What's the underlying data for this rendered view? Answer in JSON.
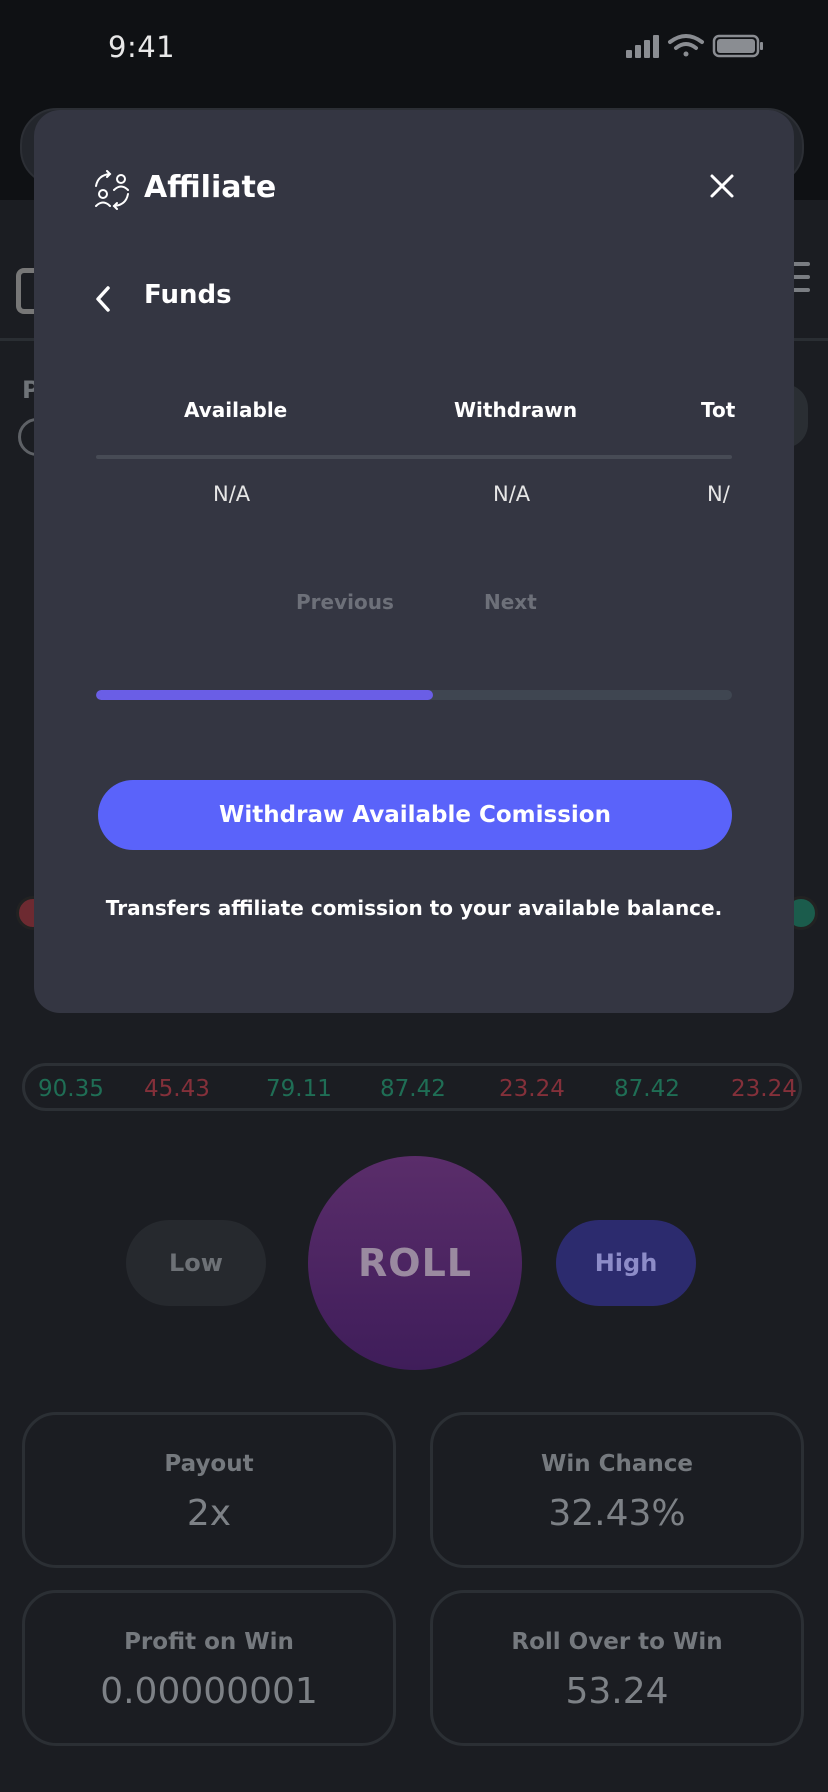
{
  "status_bar": {
    "time": "9:41"
  },
  "background": {
    "partial_label": "P",
    "history": [
      {
        "value": "90.35",
        "color": "green"
      },
      {
        "value": "45.43",
        "color": "red"
      },
      {
        "value": "79.11",
        "color": "green"
      },
      {
        "value": "87.42",
        "color": "green"
      },
      {
        "value": "23.24",
        "color": "red"
      },
      {
        "value": "87.42",
        "color": "green"
      },
      {
        "value": "23.24",
        "color": "red"
      }
    ],
    "buttons": {
      "low": "Low",
      "roll": "ROLL",
      "high": "High"
    },
    "stats": {
      "payout": {
        "label": "Payout",
        "value": "2x"
      },
      "win_chance": {
        "label": "Win Chance",
        "value": "32.43%"
      },
      "profit_on_win": {
        "label": "Profit on Win",
        "value": "0.00000001"
      },
      "roll_over": {
        "label": "Roll Over to Win",
        "value": "53.24"
      }
    }
  },
  "modal": {
    "title": "Affiliate",
    "section": "Funds",
    "table": {
      "headers": [
        "Available",
        "Withdrawn",
        "Tot"
      ],
      "values": [
        "N/A",
        "N/A",
        "N/"
      ]
    },
    "pagination": {
      "previous": "Previous",
      "next": "Next"
    },
    "progress": 0.53,
    "withdraw_button": "Withdraw Available Comission",
    "withdraw_note": "Transfers affiliate comission to your available balance."
  },
  "colors": {
    "accent": "#5a63fa",
    "progress": "#6a5ee6",
    "modal_bg": "#343642",
    "positive": "#1f6e55",
    "negative": "#84303a"
  }
}
